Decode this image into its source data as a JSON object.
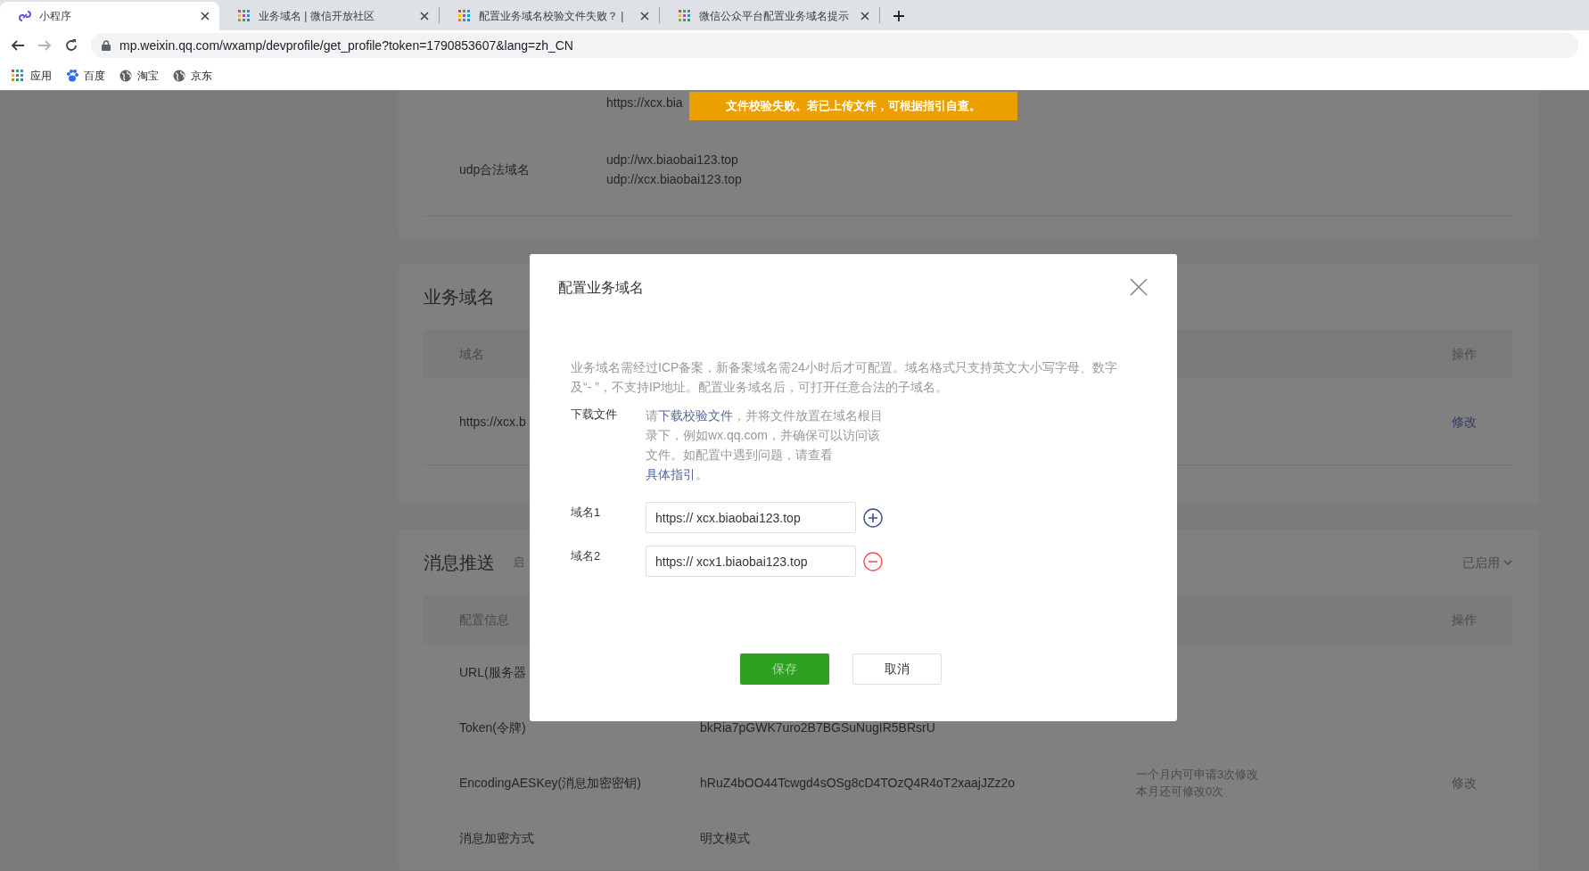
{
  "browser": {
    "tabs": [
      {
        "title": "小程序",
        "selected": true
      },
      {
        "title": "业务域名 | 微信开放社区",
        "selected": false
      },
      {
        "title": "配置业务域名校验文件失败？ |",
        "selected": false
      },
      {
        "title": "微信公众平台配置业务域名提示",
        "selected": false
      }
    ],
    "url": "mp.weixin.qq.com/wxamp/devprofile/get_profile?token=1790853607&lang=zh_CN",
    "bookmarks": [
      {
        "label": "应用"
      },
      {
        "label": "百度"
      },
      {
        "label": "淘宝"
      },
      {
        "label": "京东"
      }
    ]
  },
  "toast": "文件校验失败。若已上传文件，可根据指引自查。",
  "sections": [
    {
      "kind": "list",
      "rows": [
        {
          "values": [
            "https://xcx.bia"
          ]
        },
        {
          "label": "udp合法域名",
          "values": [
            "udp://wx.biaobai123.top",
            "udp://xcx.biaobai123.top"
          ]
        }
      ]
    },
    {
      "kind": "table",
      "title": "业务域名",
      "columns": {
        "column_1": "域名",
        "action": "操作"
      },
      "rows": [
        {
          "cells": [
            "https://xcx.b"
          ],
          "action": "修改",
          "action_link": true
        }
      ]
    },
    {
      "kind": "table",
      "title": "消息推送",
      "subtitle": "启",
      "status": "已启用",
      "columns": {
        "column_1": "配置信息",
        "action": "操作"
      },
      "rows": [
        {
          "cells": [
            "URL(服务器"
          ]
        },
        {
          "cells": [
            "Token(令牌)",
            "bkRia7pGWK7uro2B7BGSuNugIR5BRsrU"
          ]
        },
        {
          "cells": [
            "EncodingAESKey(消息加密密钥)",
            "hRuZ4bOO44Tcwgd4sOSg8cD4TOzQ4R4oT2xaajJZz2o",
            [
              "一个月内可申请3次修改",
              "本月还可修改0次"
            ]
          ],
          "action": "修改",
          "action_link": false
        },
        {
          "cells": [
            "消息加密方式",
            "明文模式"
          ]
        }
      ]
    }
  ],
  "modal": {
    "title": "配置业务域名",
    "notice": "业务域名需经过ICP备案，新备案域名需24小时后才可配置。域名格式只支持英文大小写字母、数字及“- ”，不支持IP地址。配置业务域名后，可打开任意合法的子域名。",
    "download_label": "下载文件",
    "download_text": [
      {
        "text": "请"
      },
      {
        "text": "下载校验文件",
        "link": true
      },
      {
        "text": "，并将文件放置在域名根目录下，例如wx.qq.com，并确保可以访问该文件。如配置中遇到问题，请查看"
      },
      {
        "text": "具体指引",
        "link": true
      },
      {
        "text": "。"
      }
    ],
    "fields": [
      {
        "label": "域名1",
        "value": "https:// xcx.biaobai123.top",
        "kind": "add"
      },
      {
        "label": "域名2",
        "value": "https:// xcx1.biaobai123.top",
        "kind": "remove"
      }
    ],
    "buttons": [
      {
        "label": "保存",
        "kind": "primary"
      },
      {
        "label": "取消",
        "kind": "default"
      }
    ]
  }
}
